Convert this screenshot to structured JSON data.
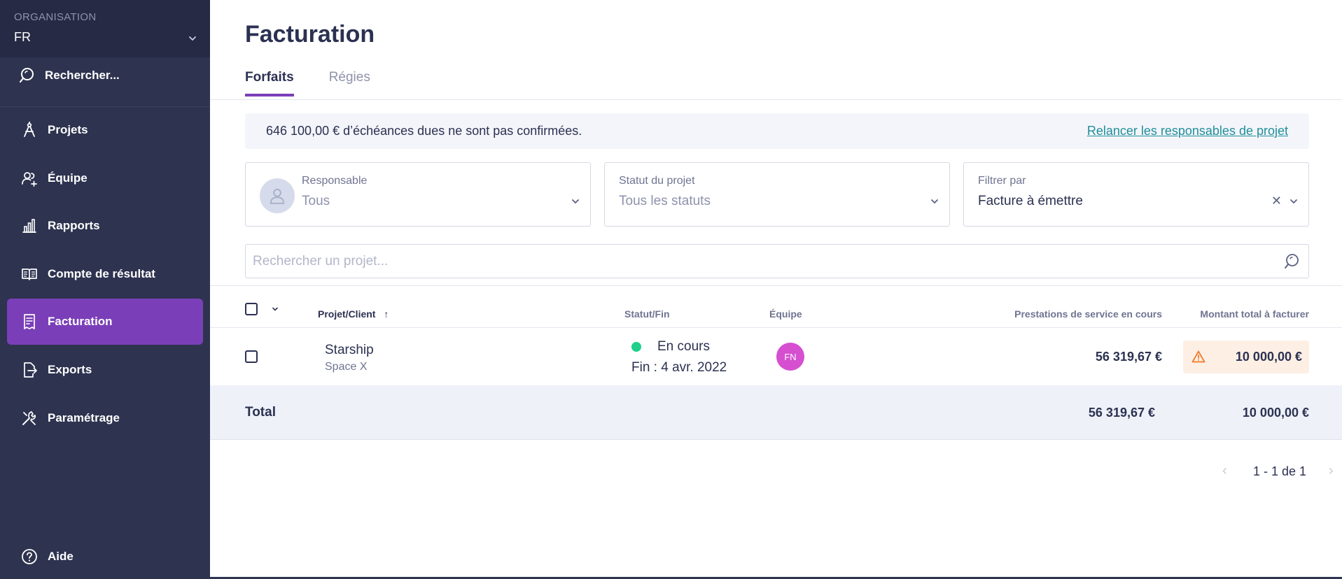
{
  "sidebar": {
    "org_label": "ORGANISATION",
    "org_value": "FR",
    "search_label": "Rechercher...",
    "items": [
      {
        "label": "Projets",
        "icon": "compass-icon"
      },
      {
        "label": "Équipe",
        "icon": "team-icon"
      },
      {
        "label": "Rapports",
        "icon": "bar-chart-icon"
      },
      {
        "label": "Compte de résultat",
        "icon": "ledger-icon"
      },
      {
        "label": "Facturation",
        "icon": "invoice-icon",
        "active": true
      },
      {
        "label": "Exports",
        "icon": "export-icon"
      },
      {
        "label": "Paramétrage",
        "icon": "tools-icon"
      }
    ],
    "help_label": "Aide"
  },
  "main": {
    "title": "Facturation",
    "tabs": [
      {
        "label": "Forfaits",
        "active": true
      },
      {
        "label": "Régies",
        "active": false
      }
    ],
    "banner": {
      "text": "646 100,00 € d’échéances dues ne sont pas confirmées.",
      "link": "Relancer les responsables de projet"
    },
    "filters": {
      "responsable": {
        "label": "Responsable",
        "value": "Tous"
      },
      "statut": {
        "label": "Statut du projet",
        "value": "Tous les statuts"
      },
      "filtrer": {
        "label": "Filtrer par",
        "value": "Facture à émettre"
      }
    },
    "search": {
      "placeholder": "Rechercher un projet..."
    },
    "table": {
      "columns": {
        "project": "Projet/Client",
        "status": "Statut/Fin",
        "team": "Équipe",
        "services": "Prestations de service en cours",
        "total": "Montant total à facturer"
      },
      "rows": [
        {
          "project": "Starship",
          "client": "Space X",
          "status": "En cours",
          "end": "Fin : 4 avr. 2022",
          "team_initials": "FN",
          "services": "56 319,67 €",
          "total": "10 000,00 €"
        }
      ],
      "totals": {
        "label": "Total",
        "services": "56 319,67 €",
        "total": "10 000,00 €"
      }
    },
    "pagination": {
      "text": "1 - 1 de 1"
    },
    "colors": {
      "sidebar_bg": "#2e3350",
      "accent": "#7a3fb8",
      "link": "#1f8f9a",
      "status_active": "#1fcf8a",
      "avatar": "#d54fd0",
      "warning": "#f07a2b"
    }
  }
}
